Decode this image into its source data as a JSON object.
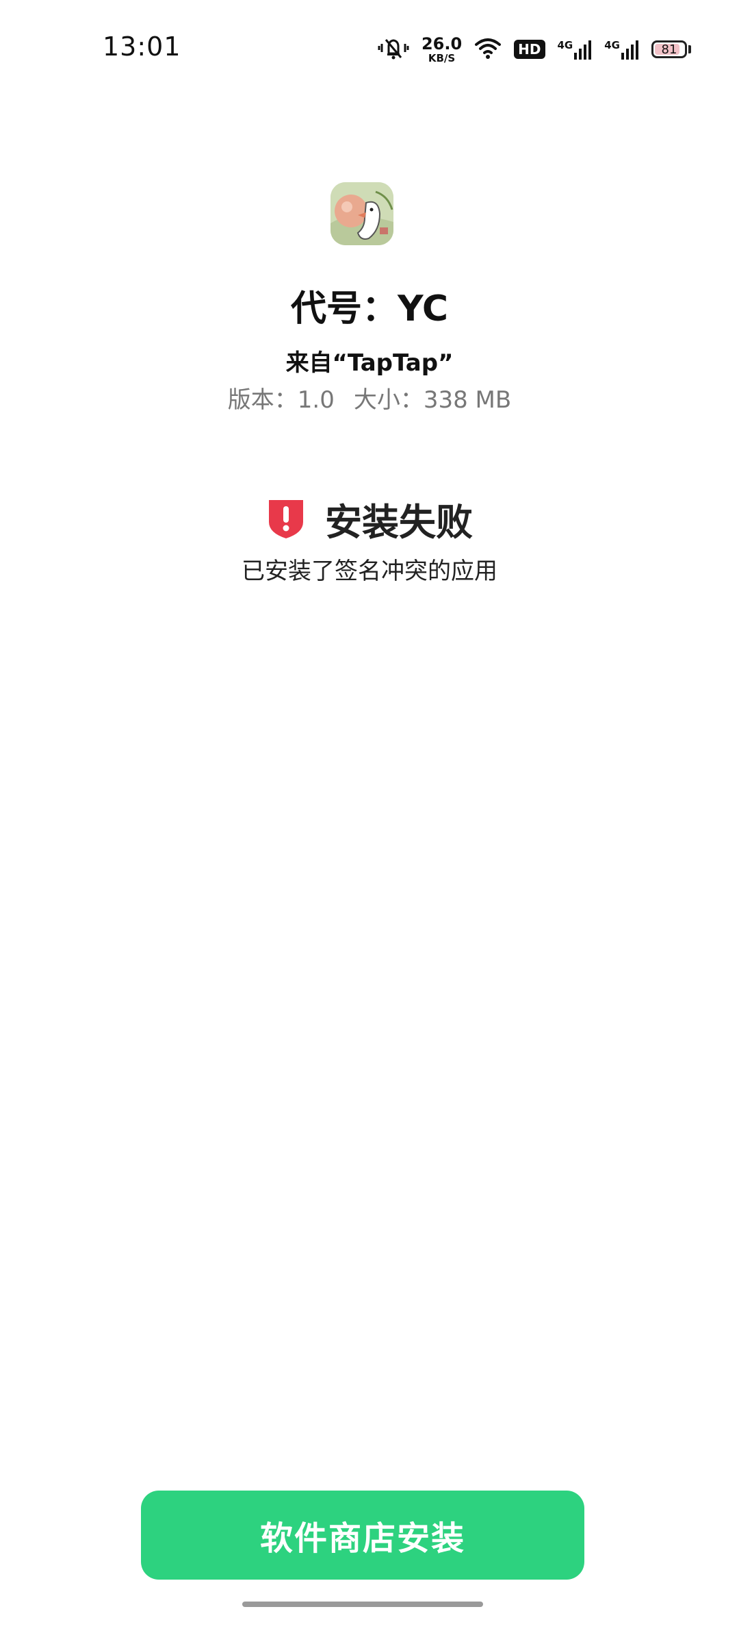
{
  "status_bar": {
    "time": "13:01",
    "net_speed": "26.0",
    "net_speed_unit": "KB/S",
    "hd_badge": "HD",
    "sim1_label": "4G",
    "sim2_label": "4G",
    "battery_level": "81",
    "icons": [
      "vibrate-silent-icon",
      "wifi-icon",
      "signal-icon",
      "battery-icon"
    ]
  },
  "app": {
    "icon": "app-icon",
    "title": "代号：YC",
    "source": "来自“TapTap”",
    "version": "版本：1.0",
    "size": "大小：338 MB"
  },
  "error": {
    "icon": "shield-alert-icon",
    "title": "安装失败",
    "description": "已安装了签名冲突的应用"
  },
  "actions": {
    "store_install_label": "软件商店安装"
  },
  "colors": {
    "accent": "#2dd27f",
    "error": "#e8394a"
  }
}
